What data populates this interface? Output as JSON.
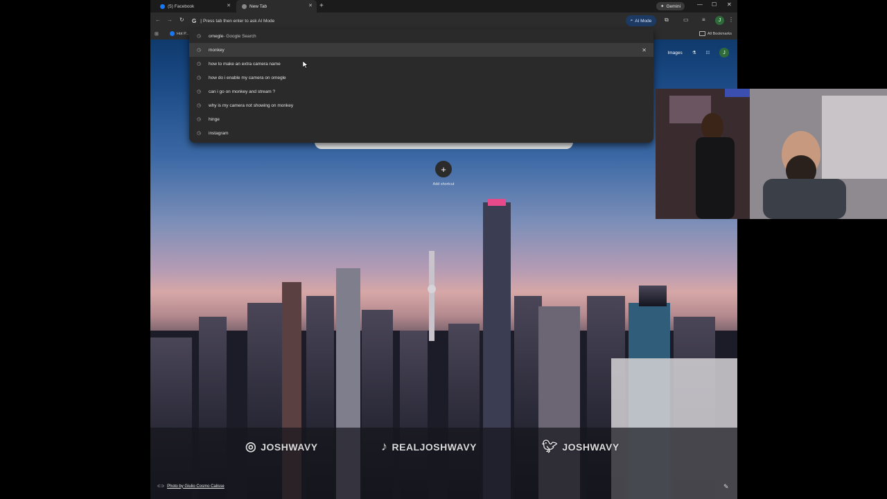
{
  "tabs": [
    {
      "title": "(5) Facebook",
      "active": false
    },
    {
      "title": "New Tab",
      "active": true
    }
  ],
  "gemini_label": "Gemini",
  "omnibox": {
    "text": "Press tab then enter to ask AI Mode"
  },
  "ai_mode_label": "AI Mode",
  "profile_initial": "J",
  "bookmarks": {
    "item": "Hot P...",
    "all": "All Bookmarks"
  },
  "suggestions": [
    {
      "text": "omegle",
      "suffix": " - Google Search"
    },
    {
      "text": "monkey",
      "suffix": ""
    },
    {
      "text": "how to make an extra camera name",
      "suffix": ""
    },
    {
      "text": "how do i enable my camera on omegle",
      "suffix": ""
    },
    {
      "text": "can i go on monkey and stream ?",
      "suffix": ""
    },
    {
      "text": "why is my camera not showing on monkey",
      "suffix": ""
    },
    {
      "text": "hinge",
      "suffix": ""
    },
    {
      "text": "instagram",
      "suffix": ""
    }
  ],
  "ntp": {
    "images_label": "Images",
    "avatar_initial": "J",
    "add_shortcut_label": "Add shortcut",
    "credit_label": "Photo by Giulio Cosmo Calisse"
  },
  "overlay": {
    "instagram": "JOSHWAVY",
    "tiktok": "REALJOSHWAVY",
    "twitter": "JOSHWAVY"
  },
  "colors": {
    "ai_mode_bg": "#1d3a63",
    "avatar_bg": "#2f6b3a",
    "facebook_blue": "#1877f2"
  }
}
